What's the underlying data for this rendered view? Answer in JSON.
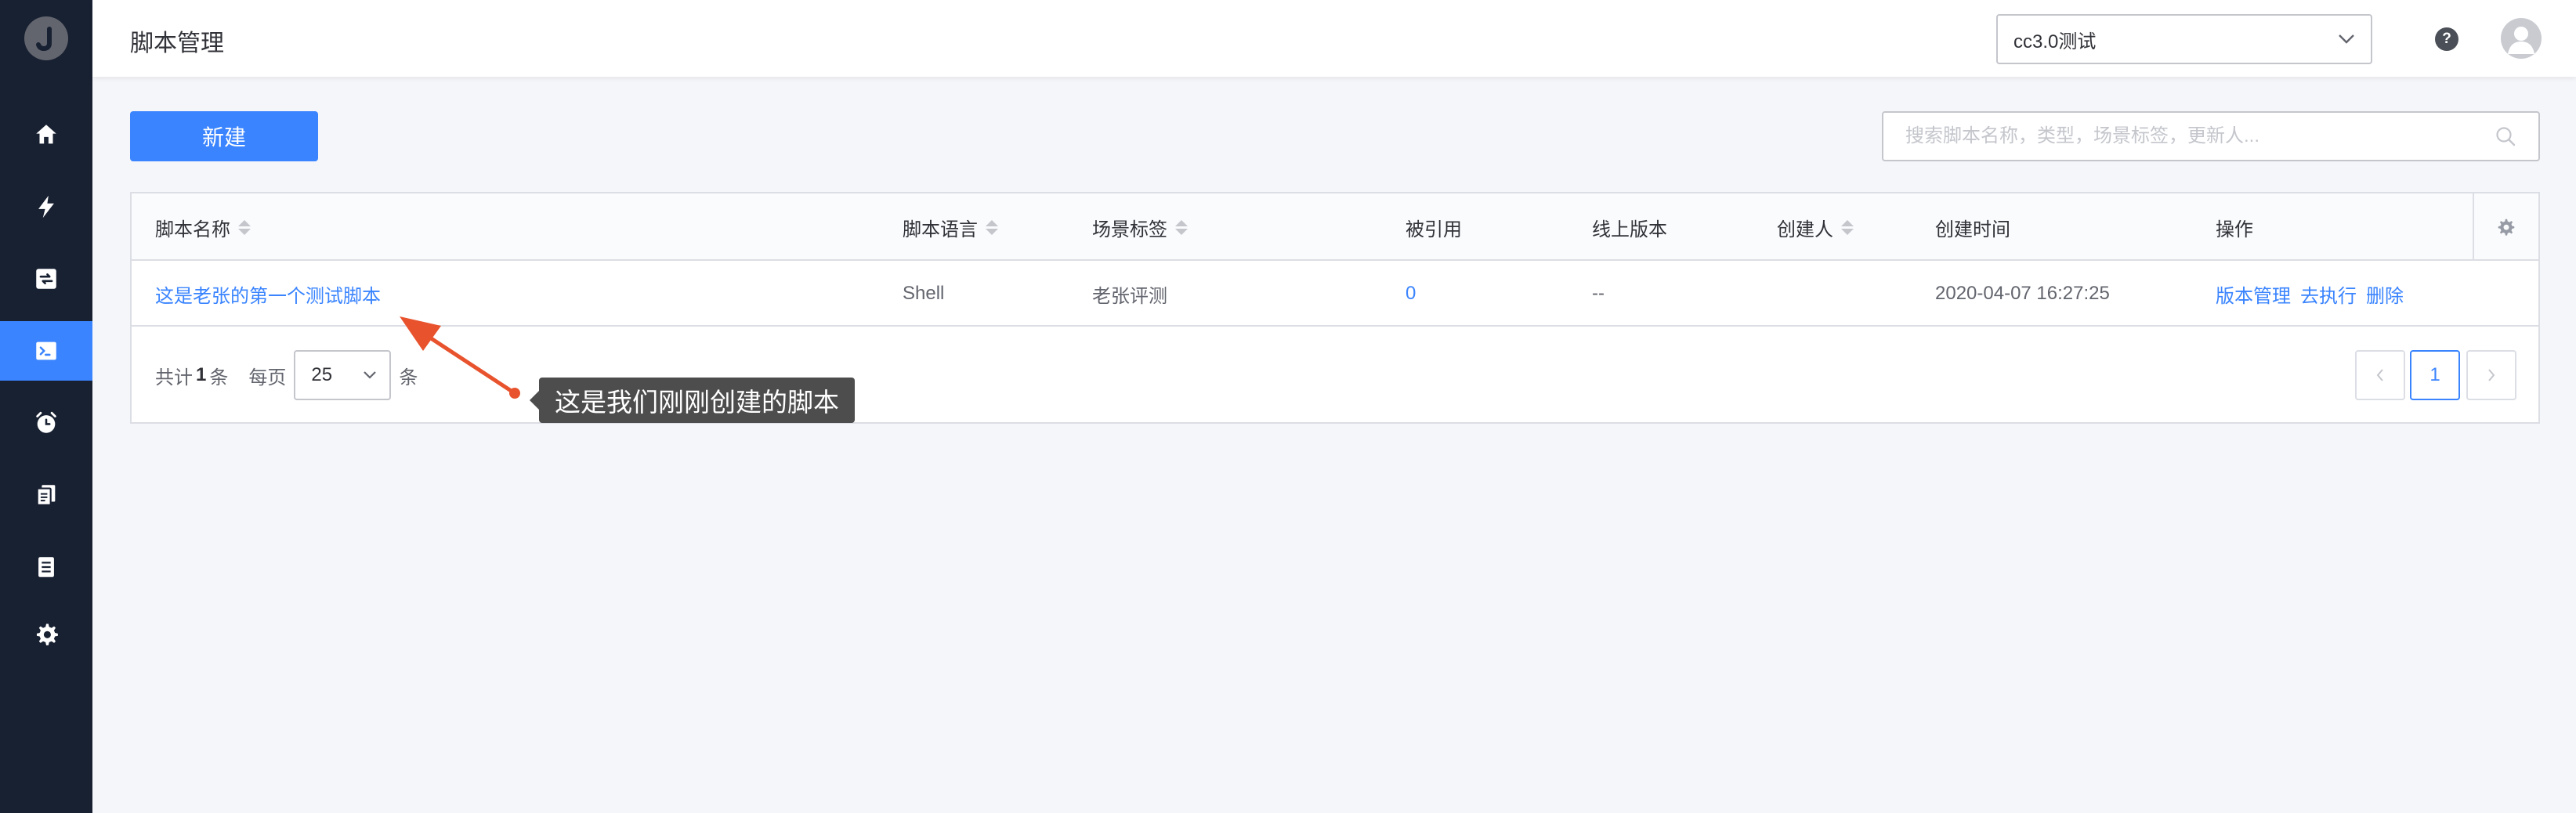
{
  "sidebar": {
    "logo_letter": "J",
    "items": [
      {
        "icon": "home-icon"
      },
      {
        "icon": "lightning-icon"
      },
      {
        "icon": "refresh-icon"
      },
      {
        "icon": "terminal-icon",
        "active": true
      },
      {
        "icon": "clock-icon"
      },
      {
        "icon": "files-icon"
      },
      {
        "icon": "document-icon"
      },
      {
        "icon": "gear-icon"
      }
    ]
  },
  "header": {
    "title": "脚本管理",
    "business_select": "cc3.0测试",
    "help_label": "?"
  },
  "toolbar": {
    "new_label": "新建",
    "search_placeholder": "搜索脚本名称，类型，场景标签，更新人..."
  },
  "table": {
    "columns": {
      "name": "脚本名称",
      "language": "脚本语言",
      "tags": "场景标签",
      "referenced": "被引用",
      "online_version": "线上版本",
      "creator": "创建人",
      "created_time": "创建时间",
      "actions": "操作"
    },
    "rows": [
      {
        "name": "这是老张的第一个测试脚本",
        "language": "Shell",
        "tags": "老张评测",
        "referenced": "0",
        "online_version": "--",
        "creator": "",
        "created_time": "2020-04-07 16:27:25",
        "actions": [
          "版本管理",
          "去执行",
          "删除"
        ]
      }
    ]
  },
  "pagination": {
    "total_prefix": "共计",
    "total": "1",
    "total_suffix": "条",
    "per_page_label": "每页",
    "page_size": "25",
    "per_page_suffix": "条",
    "current_page": "1"
  },
  "annotation": {
    "text": "这是我们刚刚创建的脚本"
  },
  "colors": {
    "primary": "#3a84ff",
    "sidebar_bg": "#182132",
    "annotation_arrow": "#e8532e"
  }
}
